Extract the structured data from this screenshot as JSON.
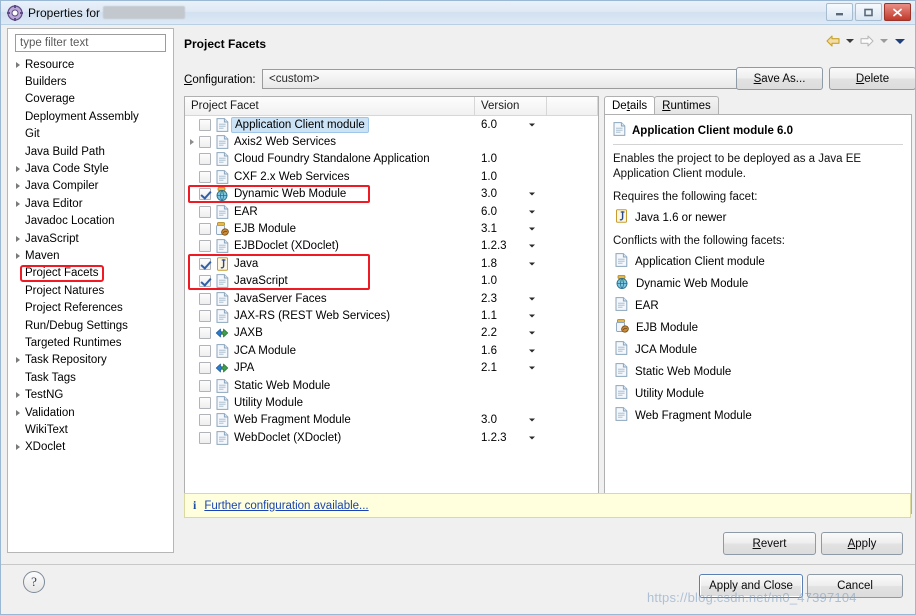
{
  "window": {
    "title_prefix": "Properties for",
    "title_redacted": true,
    "icon": "eclipse-properties-icon",
    "minimize_label": "",
    "maximize_label": "",
    "close_label": ""
  },
  "sidebar": {
    "filter": {
      "value": "",
      "placeholder": "type filter text"
    },
    "items": [
      {
        "label": "Resource",
        "expandable": true,
        "selected": false
      },
      {
        "label": "Builders",
        "expandable": false,
        "selected": false
      },
      {
        "label": "Coverage",
        "expandable": false,
        "selected": false
      },
      {
        "label": "Deployment Assembly",
        "expandable": false,
        "selected": false
      },
      {
        "label": "Git",
        "expandable": false,
        "selected": false
      },
      {
        "label": "Java Build Path",
        "expandable": false,
        "selected": false
      },
      {
        "label": "Java Code Style",
        "expandable": true,
        "selected": false
      },
      {
        "label": "Java Compiler",
        "expandable": true,
        "selected": false
      },
      {
        "label": "Java Editor",
        "expandable": true,
        "selected": false
      },
      {
        "label": "Javadoc Location",
        "expandable": false,
        "selected": false
      },
      {
        "label": "JavaScript",
        "expandable": true,
        "selected": false
      },
      {
        "label": "Maven",
        "expandable": true,
        "selected": false
      },
      {
        "label": "Project Facets",
        "expandable": false,
        "selected": true
      },
      {
        "label": "Project Natures",
        "expandable": false,
        "selected": false
      },
      {
        "label": "Project References",
        "expandable": false,
        "selected": false
      },
      {
        "label": "Run/Debug Settings",
        "expandable": false,
        "selected": false
      },
      {
        "label": "Targeted Runtimes",
        "expandable": false,
        "selected": false
      },
      {
        "label": "Task Repository",
        "expandable": true,
        "selected": false
      },
      {
        "label": "Task Tags",
        "expandable": false,
        "selected": false
      },
      {
        "label": "TestNG",
        "expandable": true,
        "selected": false
      },
      {
        "label": "Validation",
        "expandable": true,
        "selected": false
      },
      {
        "label": "WikiText",
        "expandable": false,
        "selected": false
      },
      {
        "label": "XDoclet",
        "expandable": true,
        "selected": false
      }
    ]
  },
  "page": {
    "title": "Project Facets",
    "configuration_label": "Configuration:",
    "configuration_value": "<custom>",
    "save_as_label": "Save As...",
    "delete_label": "Delete",
    "back_icon": "back-arrow-icon",
    "forward_icon": "forward-arrow-icon",
    "menu_icon": "chevron-down-icon"
  },
  "facet_table": {
    "columns": [
      "Project Facet",
      "Version"
    ],
    "rows": [
      {
        "name": "Application Client module",
        "version": "6.0",
        "checked": false,
        "has_dropdown": true,
        "expandable": false,
        "icon": "document-icon",
        "selected": true,
        "highlight": false
      },
      {
        "name": "Axis2 Web Services",
        "version": "",
        "checked": false,
        "has_dropdown": false,
        "expandable": true,
        "icon": "document-icon",
        "selected": false,
        "highlight": false
      },
      {
        "name": "Cloud Foundry Standalone Application",
        "version": "1.0",
        "checked": false,
        "has_dropdown": false,
        "expandable": false,
        "icon": "document-icon",
        "selected": false,
        "highlight": false
      },
      {
        "name": "CXF 2.x Web Services",
        "version": "1.0",
        "checked": false,
        "has_dropdown": false,
        "expandable": false,
        "icon": "document-icon",
        "selected": false,
        "highlight": false
      },
      {
        "name": "Dynamic Web Module",
        "version": "3.0",
        "checked": true,
        "has_dropdown": true,
        "expandable": false,
        "icon": "globe-module-icon",
        "selected": false,
        "highlight": true
      },
      {
        "name": "EAR",
        "version": "6.0",
        "checked": false,
        "has_dropdown": true,
        "expandable": false,
        "icon": "document-icon",
        "selected": false,
        "highlight": false
      },
      {
        "name": "EJB Module",
        "version": "3.1",
        "checked": false,
        "has_dropdown": true,
        "expandable": false,
        "icon": "bean-module-icon",
        "selected": false,
        "highlight": false
      },
      {
        "name": "EJBDoclet (XDoclet)",
        "version": "1.2.3",
        "checked": false,
        "has_dropdown": true,
        "expandable": false,
        "icon": "document-icon",
        "selected": false,
        "highlight": false
      },
      {
        "name": "Java",
        "version": "1.8",
        "checked": true,
        "has_dropdown": true,
        "expandable": false,
        "icon": "java-icon",
        "selected": false,
        "highlight": true
      },
      {
        "name": "JavaScript",
        "version": "1.0",
        "checked": true,
        "has_dropdown": false,
        "expandable": false,
        "icon": "document-icon",
        "selected": false,
        "highlight": true
      },
      {
        "name": "JavaServer Faces",
        "version": "2.3",
        "checked": false,
        "has_dropdown": true,
        "expandable": false,
        "icon": "document-icon",
        "selected": false,
        "highlight": false
      },
      {
        "name": "JAX-RS (REST Web Services)",
        "version": "1.1",
        "checked": false,
        "has_dropdown": true,
        "expandable": false,
        "icon": "document-icon",
        "selected": false,
        "highlight": false
      },
      {
        "name": "JAXB",
        "version": "2.2",
        "checked": false,
        "has_dropdown": true,
        "expandable": false,
        "icon": "arrows-icon",
        "selected": false,
        "highlight": false
      },
      {
        "name": "JCA Module",
        "version": "1.6",
        "checked": false,
        "has_dropdown": true,
        "expandable": false,
        "icon": "document-icon",
        "selected": false,
        "highlight": false
      },
      {
        "name": "JPA",
        "version": "2.1",
        "checked": false,
        "has_dropdown": true,
        "expandable": false,
        "icon": "arrows-icon",
        "selected": false,
        "highlight": false
      },
      {
        "name": "Static Web Module",
        "version": "",
        "checked": false,
        "has_dropdown": false,
        "expandable": false,
        "icon": "document-icon",
        "selected": false,
        "highlight": false
      },
      {
        "name": "Utility Module",
        "version": "",
        "checked": false,
        "has_dropdown": false,
        "expandable": false,
        "icon": "document-icon",
        "selected": false,
        "highlight": false
      },
      {
        "name": "Web Fragment Module",
        "version": "3.0",
        "checked": false,
        "has_dropdown": true,
        "expandable": false,
        "icon": "document-icon",
        "selected": false,
        "highlight": false
      },
      {
        "name": "WebDoclet (XDoclet)",
        "version": "1.2.3",
        "checked": false,
        "has_dropdown": true,
        "expandable": false,
        "icon": "document-icon",
        "selected": false,
        "highlight": false
      }
    ]
  },
  "details": {
    "tabs": [
      {
        "label": "Details",
        "active": true
      },
      {
        "label": "Runtimes",
        "active": false
      }
    ],
    "heading": "Application Client module 6.0",
    "heading_icon": "document-icon",
    "description": "Enables the project to be deployed as a Java EE Application Client module.",
    "requires_label": "Requires the following facet:",
    "requires": [
      {
        "label": "Java 1.6 or newer",
        "icon": "java-icon"
      }
    ],
    "conflicts_label": "Conflicts with the following facets:",
    "conflicts": [
      {
        "label": "Application Client module",
        "icon": "document-icon"
      },
      {
        "label": "Dynamic Web Module",
        "icon": "globe-module-icon"
      },
      {
        "label": "EAR",
        "icon": "document-icon"
      },
      {
        "label": "EJB Module",
        "icon": "bean-module-icon"
      },
      {
        "label": "JCA Module",
        "icon": "document-icon"
      },
      {
        "label": "Static Web Module",
        "icon": "document-icon"
      },
      {
        "label": "Utility Module",
        "icon": "document-icon"
      },
      {
        "label": "Web Fragment Module",
        "icon": "document-icon"
      }
    ]
  },
  "infobar": {
    "icon": "info-icon",
    "link_text": "Further configuration available..."
  },
  "buttons": {
    "revert": "Revert",
    "apply": "Apply",
    "apply_and_close": "Apply and Close",
    "cancel": "Cancel",
    "help": "?"
  },
  "watermark": "https://blog.csdn.net/m0_47397104",
  "colors": {
    "highlight_red": "#ee1b24",
    "selection_blue": "#cce3f6",
    "info_yellow": "#ffffdd",
    "checkbox_check": "#2f5fa8"
  }
}
